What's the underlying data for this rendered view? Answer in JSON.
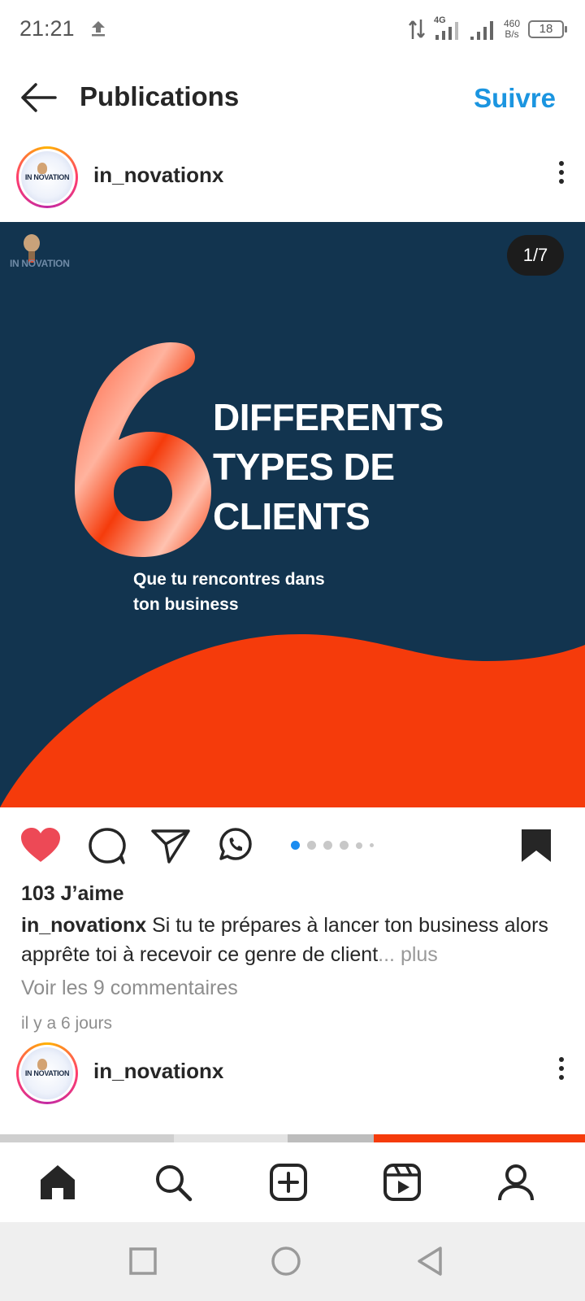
{
  "status_bar": {
    "time": "21:21",
    "net_type": "4G",
    "net_speed_value": "460",
    "net_speed_unit": "B/s",
    "battery": "18"
  },
  "header": {
    "title": "Publications",
    "follow_label": "Suivre"
  },
  "post": {
    "username": "in_novationx",
    "avatar_text": "IN NOVATION",
    "image": {
      "logo_text": "IN NOVATION",
      "counter": "1/7",
      "big_number": "6",
      "title_lines": [
        "DIFFERENTS",
        "TYPES DE",
        "CLIENTS"
      ],
      "subtitle_line1": "Que tu rencontres dans",
      "subtitle_line2": "ton business",
      "colors": {
        "background": "#12344f",
        "accent": "#f53b0b"
      }
    },
    "carousel": {
      "current_index": 1,
      "total": 7
    },
    "liked": true,
    "saved": true,
    "likes": "103 J’aime",
    "caption_user": "in_novationx",
    "caption_text": " Si tu te prépares à lancer ton business alors apprête toi à recevoir ce genre de client",
    "caption_more": "... plus",
    "comments_link": "Voir les 9 commentaires",
    "time_ago": "il y a 6 jours"
  },
  "next_post": {
    "username": "in_novationx",
    "avatar_text": "IN NOVATION"
  },
  "icons": {
    "like": "heart-icon",
    "comment": "comment-icon",
    "share": "send-icon",
    "whatsapp": "whatsapp-icon",
    "save": "bookmark-icon",
    "nav": [
      "home-icon",
      "search-icon",
      "add-post-icon",
      "reels-icon",
      "profile-icon"
    ],
    "system": [
      "recent-apps-icon",
      "home-circle-icon",
      "back-triangle-icon"
    ]
  },
  "accent_colors": {
    "link": "#1b95e0",
    "like_red": "#ed4956",
    "carousel_active": "#1a8cf0"
  }
}
